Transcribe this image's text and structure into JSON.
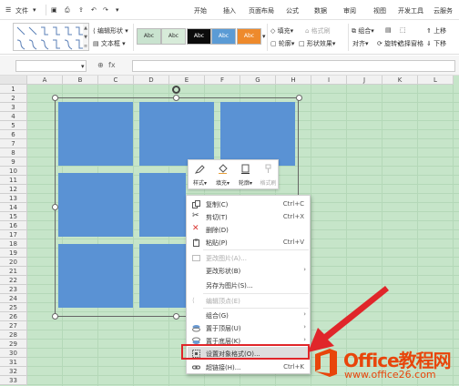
{
  "menubar": {
    "file_menu": "文件",
    "tabs": [
      "开始",
      "插入",
      "页面布局",
      "公式",
      "数据",
      "审阅",
      "视图",
      "开发工具",
      "云服务"
    ]
  },
  "ribbon": {
    "edit_shape": "编辑形状",
    "text_box": "文本框",
    "style_label": "Abc",
    "fill": "填充",
    "format_painter": "格式刷",
    "outline": "轮廓",
    "shape_effect": "形状效果",
    "group": "组合",
    "align": "对齐",
    "rotate": "旋转",
    "selection_pane": "选择窗格",
    "move_up": "上移",
    "move_down": "下移"
  },
  "formula_bar": {
    "fx_symbol": "fx"
  },
  "sheet": {
    "columns": [
      "A",
      "B",
      "C",
      "D",
      "E",
      "F",
      "G",
      "H",
      "I",
      "J",
      "K",
      "L"
    ],
    "rows": [
      "1",
      "2",
      "3",
      "4",
      "5",
      "6",
      "7",
      "8",
      "9",
      "10",
      "11",
      "12",
      "13",
      "14",
      "15",
      "16",
      "17",
      "18",
      "19",
      "20",
      "21",
      "22",
      "23",
      "24",
      "25",
      "26",
      "27",
      "28",
      "29",
      "30",
      "31",
      "32",
      "33"
    ]
  },
  "mini_toolbar": {
    "style": "样式",
    "fill": "填充",
    "outline": "轮廓",
    "format_painter": "格式刷"
  },
  "context_menu": {
    "copy": "复制(C)",
    "copy_shortcut": "Ctrl+C",
    "cut": "剪切(T)",
    "cut_shortcut": "Ctrl+X",
    "delete": "删除(D)",
    "paste": "粘贴(P)",
    "paste_shortcut": "Ctrl+V",
    "change_image": "更改图片(A)...",
    "change_shape": "更改形状(B)",
    "save_as_image": "另存为图片(S)...",
    "edit_points": "编辑顶点(E)",
    "group": "组合(G)",
    "bring_to_front": "置于顶层(U)",
    "send_to_back": "置于底层(K)",
    "format_object": "设置对象格式(O)...",
    "hyperlink": "超链接(H)...",
    "hyperlink_shortcut": "Ctrl+K"
  },
  "watermark": {
    "brand": "Office教程网",
    "url": "www.office26.com"
  },
  "colors": {
    "sheet_bg": "#c6e5c9",
    "tile": "#5a92d4",
    "highlight": "#e0262a",
    "brand": "#e8450b"
  }
}
